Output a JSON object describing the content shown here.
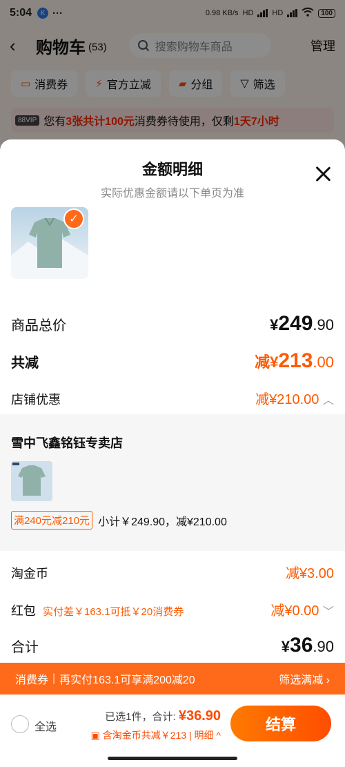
{
  "status_bar": {
    "time": "5:04",
    "app_badge": "K",
    "dots": "···",
    "net_speed": "0.98 KB/s",
    "hd1": "HD",
    "hd2": "HD",
    "battery": "100"
  },
  "header": {
    "back_icon": "back-arrow-icon",
    "title": "购物车",
    "count": "(53)",
    "search_placeholder": "搜索购物车商品",
    "manage": "管理"
  },
  "filters": [
    {
      "label": "消费券",
      "icon": "coupon-icon"
    },
    {
      "label": "官方立减",
      "icon": "lightning-icon"
    },
    {
      "label": "分组",
      "icon": "folder-icon"
    },
    {
      "label": "筛选",
      "icon": "filter-icon"
    }
  ],
  "vip": {
    "tag": "88VIP",
    "pre": "您有",
    "highlight": "3张共计100元",
    "mid": "消费券待使用，仅剩",
    "time": "1天7小时"
  },
  "sheet": {
    "title": "金额明细",
    "subtitle": "实际优惠金额请以下单页为准",
    "rows": {
      "total_label": "商品总价",
      "total_yen": "¥",
      "total_int": "249",
      "total_dec": ".90",
      "reduce_label": "共减",
      "reduce_prefix": "减¥",
      "reduce_int": "213",
      "reduce_dec": ".00",
      "store_label": "店铺优惠",
      "store_value": "减¥210.00",
      "coin_label": "淘金币",
      "coin_value": "减¥3.00",
      "hongbao_label": "红包",
      "hongbao_note": "实付差￥163.1可抵￥20消费券",
      "hongbao_value": "减¥0.00",
      "sum_label": "合计",
      "sum_yen": "¥",
      "sum_int": "36",
      "sum_dec": ".90"
    },
    "store": {
      "name": "雪中飞鑫铭钰专卖店",
      "tag": "满240元减210元",
      "subtotal": "小计￥249.90，减¥210.00"
    }
  },
  "promo_bar": {
    "left": "消费券",
    "sep": "|",
    "text": "再实付163.1可享满200减20",
    "right": "筛选满减 ›"
  },
  "bottom": {
    "select_all": "全选",
    "selected": "已选1件，合计:",
    "total": "¥36.90",
    "line2": "含淘金币共减￥213 | 明细 ^",
    "checkout": "结算"
  },
  "colors": {
    "accent": "#ff5a00",
    "promo_bg": "#ff6a1a"
  }
}
